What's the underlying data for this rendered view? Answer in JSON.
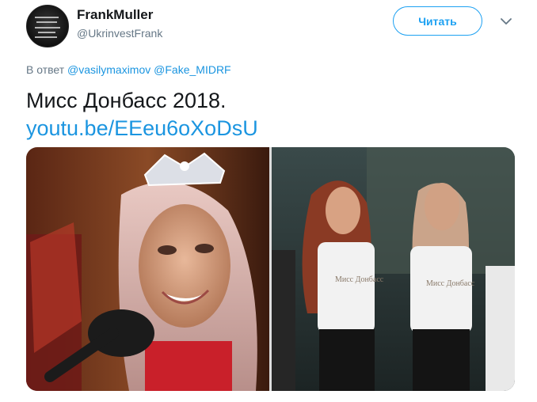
{
  "author": {
    "name": "FrankMuller",
    "handle": "@UkrinvestFrank"
  },
  "follow_button": {
    "label": "Читать"
  },
  "reply": {
    "prefix": "В ответ",
    "mentions": [
      "@vasilymaximov",
      "@Fake_MIDRF"
    ]
  },
  "tweet": {
    "text": "Мисс Донбасс 2018.",
    "link": "youtu.be/EEeu6oXoDsU"
  },
  "photos": {
    "right_shirt_text": "Мисс Донбасс"
  },
  "colors": {
    "accent": "#1da1f2",
    "link": "#1b95e0",
    "muted": "#657786",
    "text": "#14171a"
  },
  "icons": {
    "more": "chevron-down-icon",
    "avatar": "avatar"
  }
}
